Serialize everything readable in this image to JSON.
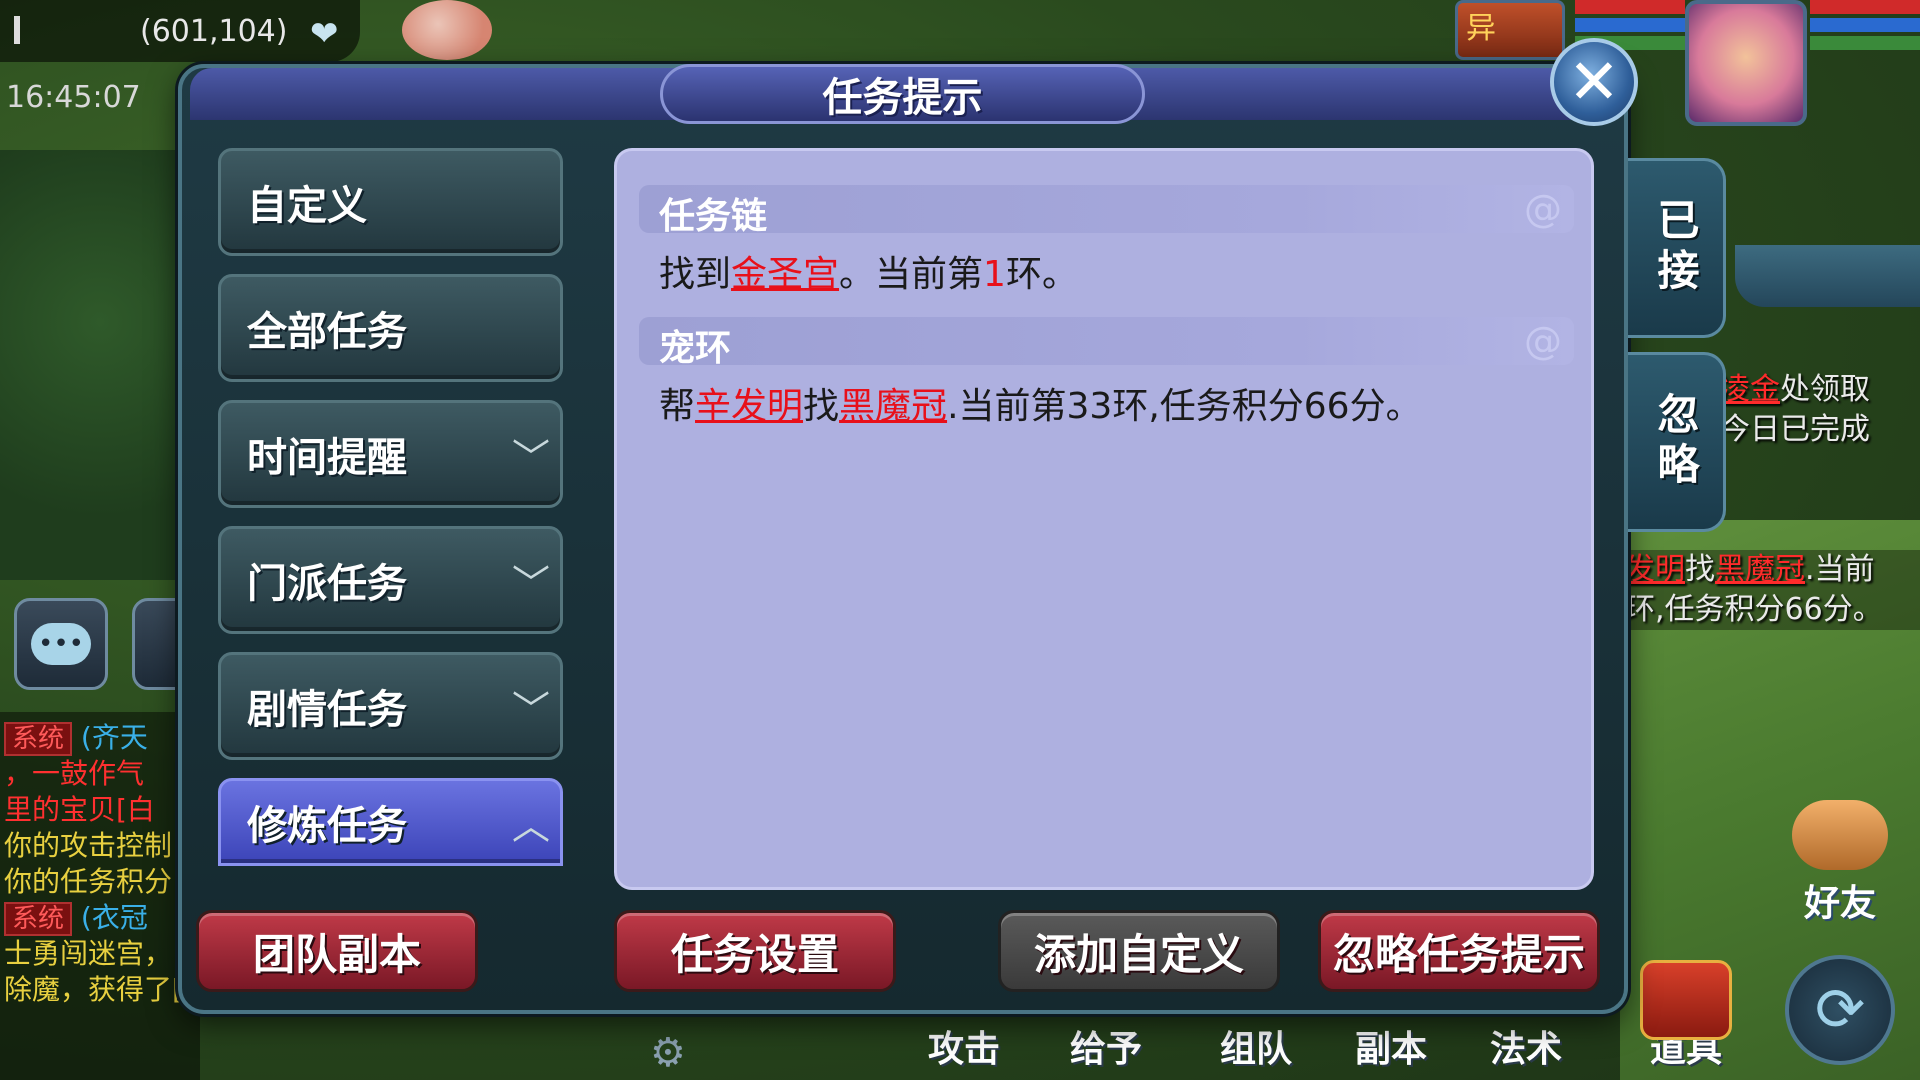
{
  "hud": {
    "coordinates": "(601,104)",
    "time": "16:45:07",
    "pet_badge": "异"
  },
  "chat": {
    "lines": [
      {
        "tag": "系统",
        "text": "(齐天"
      },
      {
        "tag": "",
        "text": "，一鼓作气"
      },
      {
        "tag": "",
        "text": "里的宝贝[白"
      },
      {
        "tag": "",
        "text": "你的攻击控制"
      },
      {
        "tag": "",
        "text": "你的任务积分"
      },
      {
        "tag": "系统",
        "text": "(衣冠"
      },
      {
        "tag": "",
        "text": "士勇闯迷宫，"
      },
      {
        "tag": "",
        "text": "除魔，获得了[舍利子]作为奖励。"
      }
    ]
  },
  "tracker": {
    "line1_link": "凌金",
    "line1_rest": "处领取",
    "line2": "今日已完成",
    "line3_link1": "发明",
    "line3_mid": "找",
    "line3_link2": "黑魔冠",
    "line3_rest": ".当前",
    "line4": "环,任务积分66分。"
  },
  "dialog": {
    "title": "任务提示",
    "categories": [
      {
        "label": "自定义",
        "chevron": ""
      },
      {
        "label": "全部任务",
        "chevron": ""
      },
      {
        "label": "时间提醒",
        "chevron": "﹀"
      },
      {
        "label": "门派任务",
        "chevron": "﹀"
      },
      {
        "label": "剧情任务",
        "chevron": "﹀"
      },
      {
        "label": "修炼任务",
        "chevron": "︿"
      }
    ],
    "sections": [
      {
        "title": "任务链",
        "text_1": "找到",
        "link_1": "金圣宫",
        "text_2": "。当前第",
        "num": "1",
        "text_3": "环。"
      },
      {
        "title": "宠环",
        "text_1": "帮",
        "link_1": "辛发明",
        "text_2": "找",
        "link_2": "黑魔冠",
        "text_3": ".当前第33环,任务积分66分。"
      }
    ],
    "side_tabs": {
      "accepted": "已接",
      "ignored": "忽略"
    },
    "buttons": {
      "team_dungeon": "团队副本",
      "task_settings": "任务设置",
      "add_custom": "添加自定义",
      "ignore_hints": "忽略任务提示"
    }
  },
  "bottom_menu": {
    "attack": "攻击",
    "give": "给予",
    "team": "组队",
    "dungeon": "副本",
    "spell": "法术",
    "items": "道具",
    "friends": "好友"
  },
  "colors": {
    "highlight_red": "#e8101a",
    "panel_bg": "#aeb0e0",
    "active_tab": "#5a63d0",
    "action_red": "#a02a38"
  }
}
